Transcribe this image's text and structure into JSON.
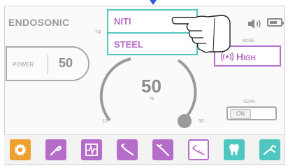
{
  "header": {
    "title": "ENDOSONIC",
    "battery_level": 0.7
  },
  "power": {
    "label": "POWER",
    "value": "50"
  },
  "tip": {
    "label": "TIP",
    "options": [
      "NITI",
      "STEEL"
    ],
    "selected": "NITI"
  },
  "dial": {
    "value": "50",
    "unit": "%",
    "min": "10",
    "max": "50",
    "level": 1.0
  },
  "mode": {
    "label": "MODE",
    "value": "High"
  },
  "scan": {
    "label": "SCAN",
    "state": "ON"
  },
  "toolbar": {
    "buttons": [
      {
        "icon": "gear-icon",
        "color": "#f0a030",
        "selected": false
      },
      {
        "icon": "scaler-tip-icon",
        "color": "#b66dc9",
        "selected": false
      },
      {
        "icon": "perio-chart-icon",
        "color": "#b66dc9",
        "selected": false
      },
      {
        "icon": "endo-file-icon",
        "color": "#b66dc9",
        "selected": false
      },
      {
        "icon": "endo-file-icon",
        "color": "#b66dc9",
        "selected": false
      },
      {
        "icon": "endo-file-icon",
        "color": "#b66dc9",
        "selected": true
      },
      {
        "icon": "tooth-icon",
        "color": "#4fc6c0",
        "selected": false
      },
      {
        "icon": "restorative-tip-icon",
        "color": "#4fc6c0",
        "selected": false
      }
    ]
  },
  "colors": {
    "accent_purple": "#b66dc9",
    "accent_teal": "#4fc6c0",
    "accent_orange": "#f0a030"
  }
}
